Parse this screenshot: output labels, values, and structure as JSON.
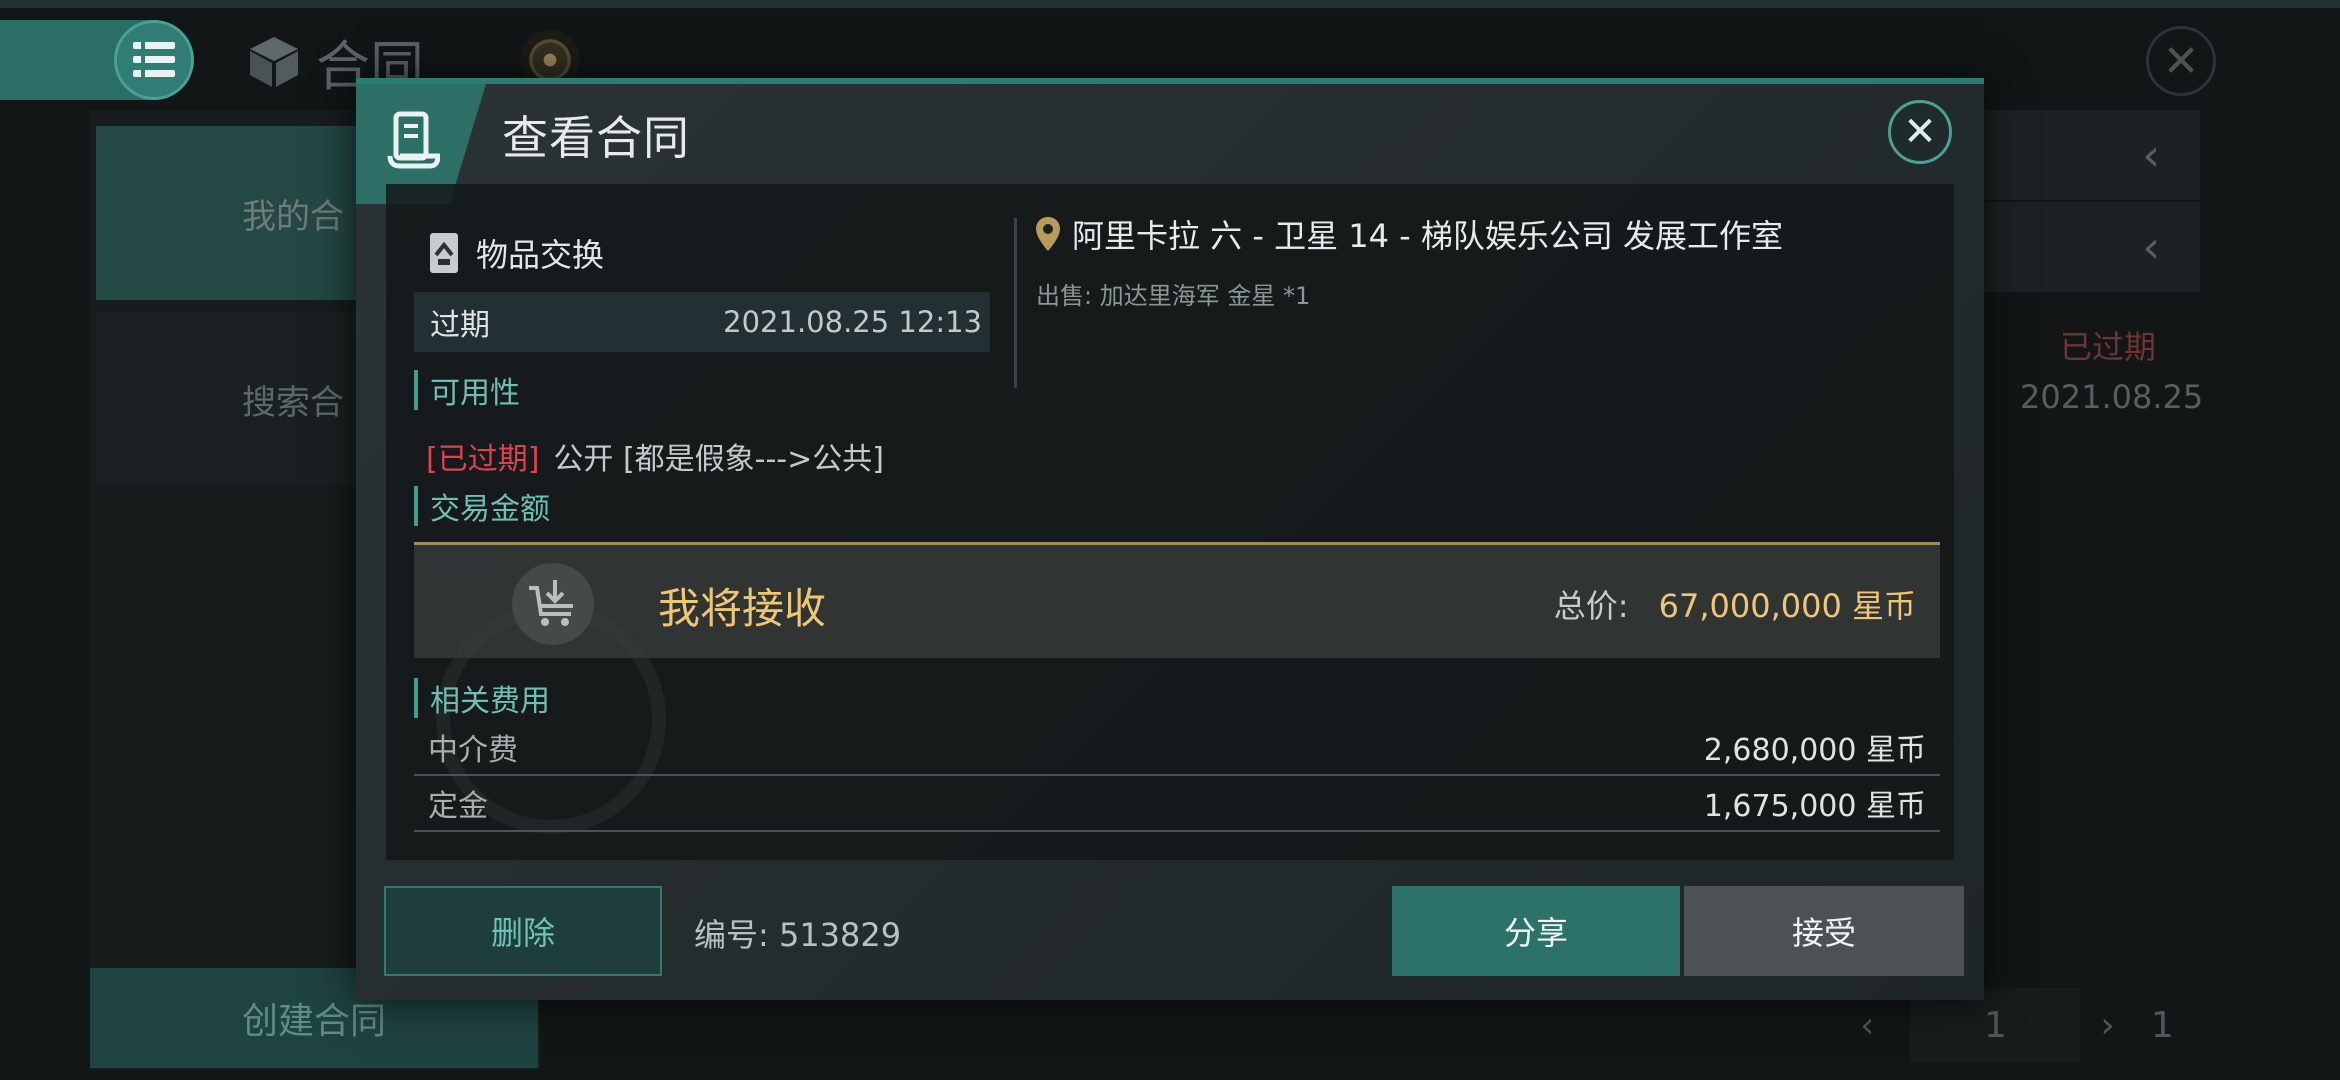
{
  "background": {
    "title": "合同",
    "tabs": [
      "我的合",
      "搜索合"
    ],
    "create_button": "创建合同",
    "list_item": {
      "status": "已过期",
      "date": "2021.08.25"
    },
    "pager": {
      "current": "1",
      "total": "1"
    }
  },
  "modal": {
    "title": "查看合同",
    "item_type": "物品交换",
    "status": "过期",
    "expire_time": "2021.08.25 12:13",
    "location": "阿里卡拉 六 - 卫星 14 - 梯队娱乐公司 发展工作室",
    "sell_line": "出售: 加达里海军 金星 *1",
    "availability_label": "可用性",
    "availability_tag": "[已过期]",
    "availability_text": "公开 [都是假象--->公共]",
    "amount_label": "交易金额",
    "receive_label": "我将接收",
    "total_label": "总价:",
    "total_value": "67,000,000 星币",
    "fees_label": "相关费用",
    "fees": [
      {
        "name": "中介费",
        "value": "2,680,000 星币"
      },
      {
        "name": "定金",
        "value": "1,675,000 星币"
      }
    ],
    "delete_button": "删除",
    "contract_number": "编号: 513829",
    "share_button": "分享",
    "accept_button": "接受"
  },
  "colors": {
    "accent": "#2d7268",
    "gold": "#f0c674",
    "expired_red": "#e0414c"
  },
  "icons": [
    "menu-icon",
    "cube-icon",
    "close-icon",
    "scroll-icon",
    "item-exchange-icon",
    "location-pin-icon",
    "cart-download-icon",
    "chevron-left-icon",
    "chevron-right-icon"
  ]
}
